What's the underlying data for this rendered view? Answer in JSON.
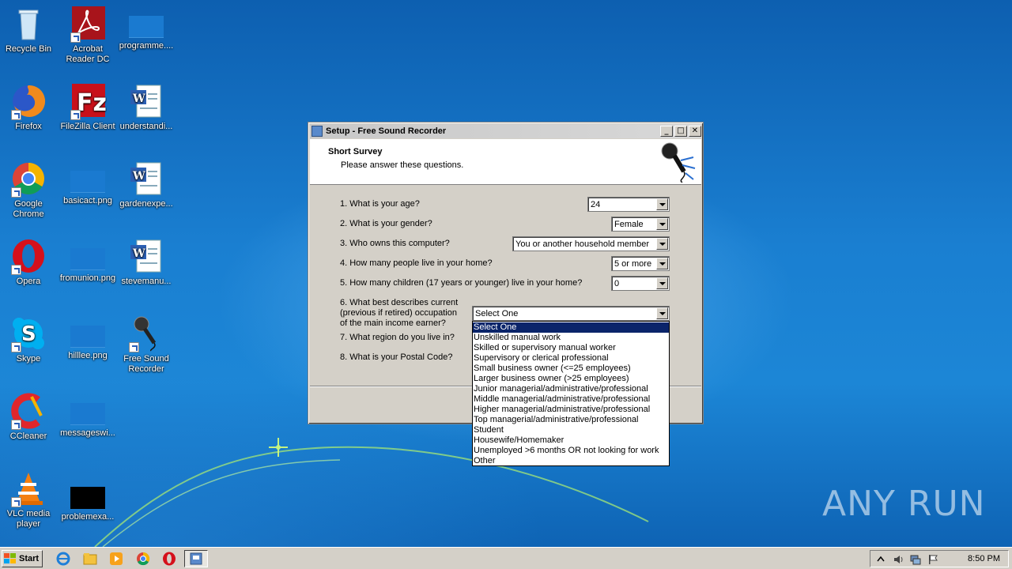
{
  "desktop": {
    "icons": [
      {
        "label": "Recycle Bin",
        "icon": "recycle-bin-icon"
      },
      {
        "label": "Acrobat Reader DC",
        "icon": "acrobat-icon"
      },
      {
        "label": "programme....",
        "icon": "image-file-icon"
      },
      {
        "label": "Firefox",
        "icon": "firefox-icon"
      },
      {
        "label": "FileZilla Client",
        "icon": "filezilla-icon"
      },
      {
        "label": "understandi...",
        "icon": "word-doc-icon"
      },
      {
        "label": "Google Chrome",
        "icon": "chrome-icon"
      },
      {
        "label": "basicact.png",
        "icon": "image-file-icon"
      },
      {
        "label": "gardenexpe...",
        "icon": "word-doc-icon"
      },
      {
        "label": "Opera",
        "icon": "opera-icon"
      },
      {
        "label": "fromunion.png",
        "icon": "image-file-icon"
      },
      {
        "label": "stevemanu...",
        "icon": "word-doc-icon"
      },
      {
        "label": "Skype",
        "icon": "skype-icon"
      },
      {
        "label": "hilllee.png",
        "icon": "image-file-icon"
      },
      {
        "label": "Free Sound Recorder",
        "icon": "microphone-icon"
      },
      {
        "label": "CCleaner",
        "icon": "ccleaner-icon"
      },
      {
        "label": "messageswi...",
        "icon": "image-file-icon"
      },
      {
        "label": "VLC media player",
        "icon": "vlc-icon"
      },
      {
        "label": "problemexa...",
        "icon": "image-file-icon"
      }
    ]
  },
  "dialog": {
    "title": "Setup - Free Sound Recorder",
    "header_title": "Short Survey",
    "header_subtitle": "Please answer these questions.",
    "questions": [
      {
        "label": "1. What is your age?",
        "value": "24"
      },
      {
        "label": "2. What is your gender?",
        "value": "Female"
      },
      {
        "label": "3. Who owns this computer?",
        "value": "You or another household member"
      },
      {
        "label": "4. How many people live in your home?",
        "value": "5 or more"
      },
      {
        "label": "5. How many children (17 years or younger) live in your home?",
        "value": "0"
      },
      {
        "label_lines": [
          "6. What best describes current",
          "(previous if retired) occupation",
          "of the main income earner?"
        ],
        "value": "Select One"
      },
      {
        "label": "7. What region do you live in?"
      },
      {
        "label": "8. What is your Postal Code?"
      }
    ],
    "dropdown_options": [
      "Select One",
      "Unskilled manual work",
      "Skilled or supervisory manual worker",
      "Supervisory or clerical professional",
      "Small business owner (<=25 employees)",
      "Larger business owner (>25 employees)",
      "Junior managerial/administrative/professional",
      "Middle managerial/administrative/professional",
      "Higher managerial/administrative/professional",
      "Top managerial/administrative/professional",
      "Student",
      "Housewife/Homemaker",
      "Unemployed >6 months OR not looking for work",
      "Other"
    ],
    "dropdown_selected_index": 0
  },
  "taskbar": {
    "start_label": "Start",
    "clock": "8:50 PM"
  },
  "watermark": "ANY RUN"
}
